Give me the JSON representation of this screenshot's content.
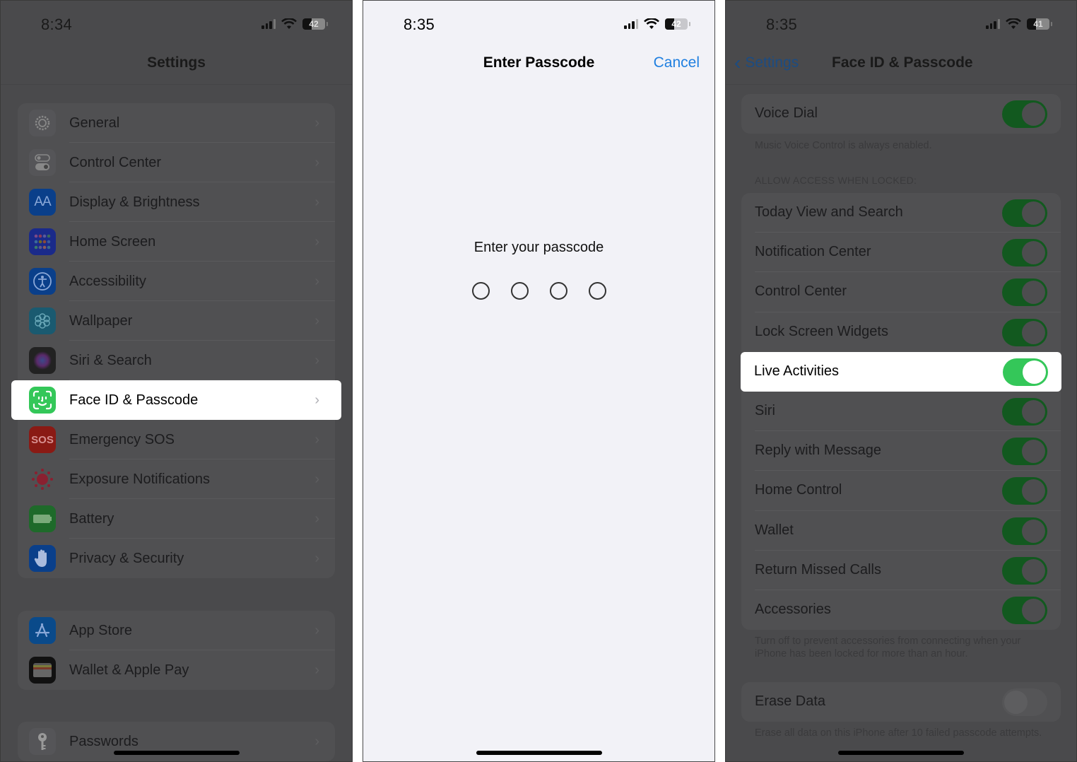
{
  "screen1": {
    "time": "8:34",
    "battery": "42",
    "title": "Settings",
    "groups": [
      [
        {
          "label": "General",
          "icon": "gear-icon",
          "color": "#555558"
        },
        {
          "label": "Control Center",
          "icon": "toggles-icon",
          "color": "#555558"
        },
        {
          "label": "Display & Brightness",
          "icon": "text-size-icon",
          "color": "#0a3f8a"
        },
        {
          "label": "Home Screen",
          "icon": "app-grid-icon",
          "color": "#1a2a8a"
        },
        {
          "label": "Accessibility",
          "icon": "accessibility-icon",
          "color": "#0a3f8a"
        },
        {
          "label": "Wallpaper",
          "icon": "flower-icon",
          "color": "#1a5a70"
        },
        {
          "label": "Siri & Search",
          "icon": "siri-icon",
          "color": "#222"
        },
        {
          "label": "Face ID & Passcode",
          "icon": "face-id-icon",
          "color": "#34c759",
          "highlighted": true
        },
        {
          "label": "Emergency SOS",
          "icon": "sos-icon",
          "color": "#8a1a14"
        },
        {
          "label": "Exposure Notifications",
          "icon": "exposure-icon",
          "color": "#505052"
        },
        {
          "label": "Battery",
          "icon": "battery-icon",
          "color": "#1e6a2a"
        },
        {
          "label": "Privacy & Security",
          "icon": "hand-icon",
          "color": "#0a3f8a"
        }
      ],
      [
        {
          "label": "App Store",
          "icon": "app-store-icon",
          "color": "#0a4a8a"
        },
        {
          "label": "Wallet & Apple Pay",
          "icon": "wallet-icon",
          "color": "#111"
        }
      ],
      [
        {
          "label": "Passwords",
          "icon": "key-icon",
          "color": "#555558"
        }
      ]
    ],
    "sos_text": "SOS"
  },
  "screen2": {
    "time": "8:35",
    "battery": "42",
    "title": "Enter Passcode",
    "cancel": "Cancel",
    "prompt": "Enter your passcode",
    "digits_entered": 0,
    "digits_total": 4
  },
  "screen3": {
    "time": "8:35",
    "battery": "41",
    "back_label": "Settings",
    "title": "Face ID & Passcode",
    "voice_dial": {
      "label": "Voice Dial",
      "on": true
    },
    "voice_dial_note": "Music Voice Control is always enabled.",
    "section_header": "ALLOW ACCESS WHEN LOCKED:",
    "locked_access": [
      {
        "label": "Today View and Search",
        "on": true
      },
      {
        "label": "Notification Center",
        "on": true
      },
      {
        "label": "Control Center",
        "on": true
      },
      {
        "label": "Lock Screen Widgets",
        "on": true
      },
      {
        "label": "Live Activities",
        "on": true,
        "highlighted": true
      },
      {
        "label": "Siri",
        "on": true
      },
      {
        "label": "Reply with Message",
        "on": true
      },
      {
        "label": "Home Control",
        "on": true
      },
      {
        "label": "Wallet",
        "on": true
      },
      {
        "label": "Return Missed Calls",
        "on": true
      },
      {
        "label": "Accessories",
        "on": true
      }
    ],
    "accessories_note": "Turn off to prevent accessories from connecting when your iPhone has been locked for more than an hour.",
    "erase_data": {
      "label": "Erase Data",
      "on": false
    },
    "erase_note": "Erase all data on this iPhone after 10 failed passcode attempts."
  },
  "colors": {
    "accent_blue": "#1f7fe0",
    "toggle_on": "#34c759",
    "toggle_on_dimmed": "#12591f"
  }
}
